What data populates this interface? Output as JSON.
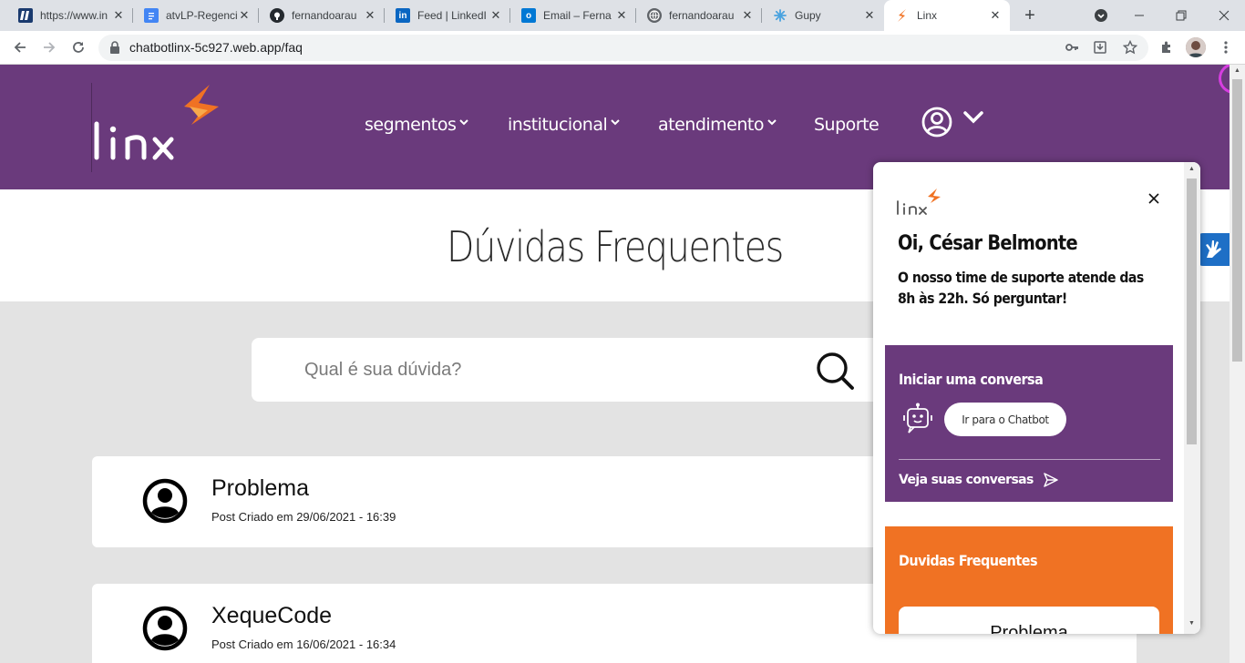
{
  "browser": {
    "tabs": [
      {
        "title": "https://www.in",
        "icon": "ifsp-icon",
        "color": "#1a3a6e"
      },
      {
        "title": "atvLP-Regenci",
        "icon": "google-docs-icon",
        "color": "#4285f4"
      },
      {
        "title": "fernandoarau",
        "icon": "github-icon",
        "color": "#24292e"
      },
      {
        "title": "Feed | LinkedI",
        "icon": "linkedin-icon",
        "color": "#0a66c2"
      },
      {
        "title": "Email – Ferna",
        "icon": "outlook-icon",
        "color": "#0078d4"
      },
      {
        "title": "fernandoarau",
        "icon": "globe-icon",
        "color": "#5f6368"
      },
      {
        "title": "Gupy",
        "icon": "gupy-icon",
        "color": "#4aa3df"
      },
      {
        "title": "Linx",
        "icon": "linx-icon",
        "color": "#f07223"
      }
    ],
    "url": "chatbotlinx-5c927.web.app/faq"
  },
  "site": {
    "nav": {
      "segmentos": "segmentos",
      "institucional": "institucional",
      "atendimento": "atendimento",
      "suporte": "Suporte"
    },
    "page_title": "Dúvidas Frequentes",
    "search_placeholder": "Qual é sua dúvida?",
    "posts": [
      {
        "title": "Problema",
        "date": "Post Criado em 29/06/2021 - 16:39"
      },
      {
        "title": "XequeCode",
        "date": "Post Criado em 16/06/2021 - 16:34"
      }
    ],
    "brand_purple": "#6a3a7c",
    "brand_orange": "#f07223"
  },
  "widget": {
    "greeting": "Oi, César Belmonte",
    "subtitle_line1": "O nosso time de suporte atende das",
    "subtitle_line2": "8h às 22h. Só perguntar!",
    "chat_section_title": "Iniciar uma conversa",
    "chat_button": "Ir para o Chatbot",
    "see_conversations": "Veja suas conversas",
    "faq_section_title": "Duvidas Frequentes",
    "faq_first_item": "Problema"
  }
}
